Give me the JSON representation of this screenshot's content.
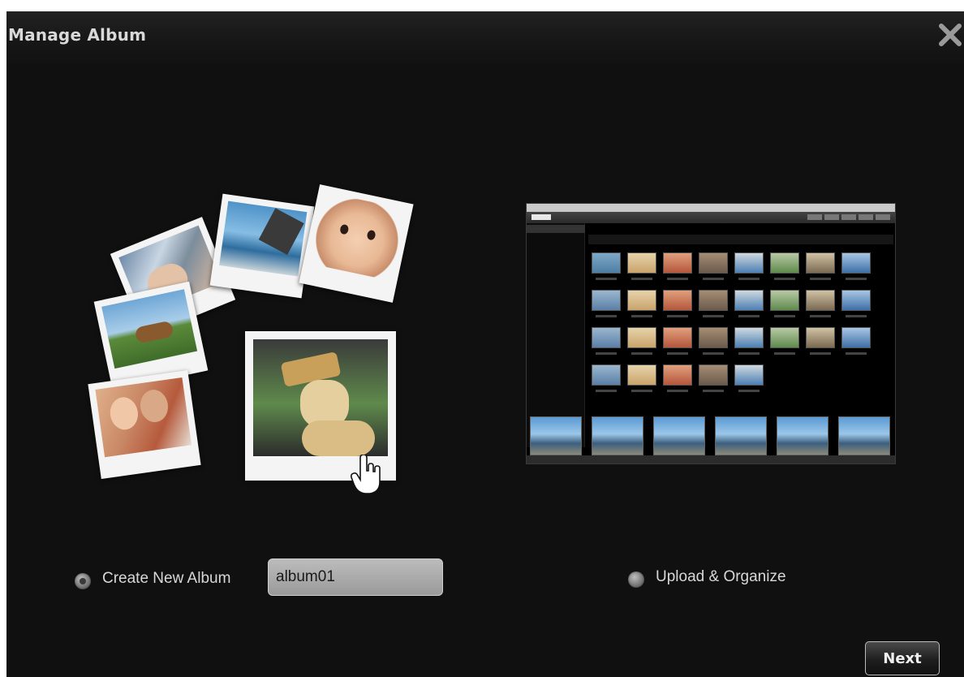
{
  "dialog": {
    "title": "Manage Album",
    "close_icon": "close-icon"
  },
  "options": {
    "create_new_album": {
      "label": "Create New Album",
      "selected": true
    },
    "album_name": {
      "value": "album01"
    },
    "upload_organize": {
      "label": "Upload & Organize",
      "selected": false
    }
  },
  "footer": {
    "next_label": "Next"
  },
  "colors": {
    "background": "#101010",
    "text": "#d8d8d8",
    "input_background": "#a8a8a8"
  }
}
